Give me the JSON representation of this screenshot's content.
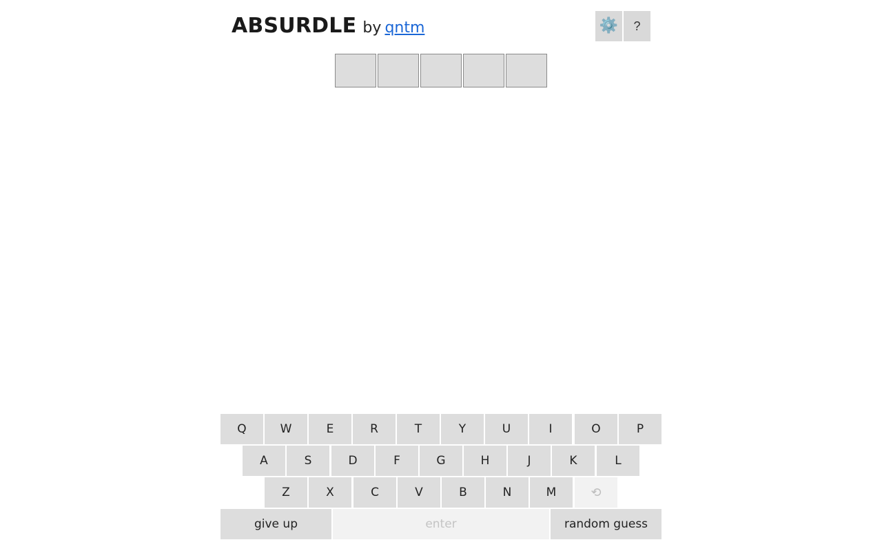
{
  "header": {
    "title": "ABSURDLE",
    "by": "by",
    "author": "qntm",
    "settings_icon": "⚙️",
    "help_label": "?"
  },
  "guess_row": {
    "cells": [
      "",
      "",
      "",
      "",
      ""
    ]
  },
  "keyboard": {
    "row1": [
      "Q",
      "W",
      "E",
      "R",
      "T",
      "Y",
      "U",
      "I",
      "O",
      "P"
    ],
    "row2": [
      "A",
      "S",
      "D",
      "F",
      "G",
      "H",
      "J",
      "K",
      "L"
    ],
    "row3": [
      "Z",
      "X",
      "C",
      "V",
      "B",
      "N",
      "M"
    ],
    "undo": "⟲",
    "give_up": "give up",
    "enter": "enter",
    "random_guess": "random guess"
  },
  "colors": {
    "key_bg": "#dddddd",
    "disabled_bg": "#f2f2f2",
    "link": "#1a66d6"
  }
}
